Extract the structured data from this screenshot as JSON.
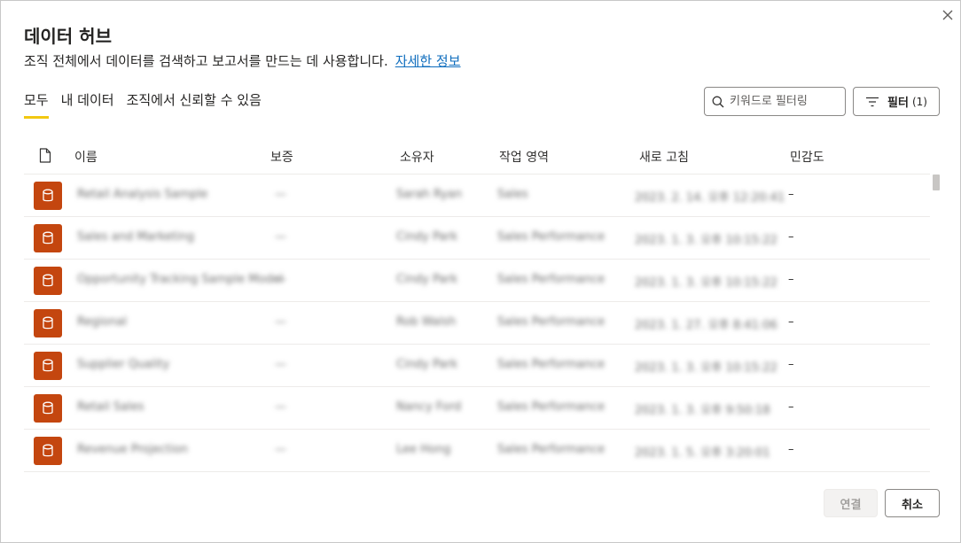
{
  "dialog": {
    "title": "데이터 허브",
    "subtitle": "조직 전체에서 데이터를 검색하고 보고서를 만드는 데 사용합니다.",
    "learn_more": "자세한 정보"
  },
  "tabs": [
    {
      "label": "모두",
      "active": true
    },
    {
      "label": "내 데이터",
      "active": false
    },
    {
      "label": "조직에서 신뢰할 수 있음",
      "active": false
    }
  ],
  "search": {
    "placeholder": "키워드로 필터링"
  },
  "filter": {
    "label": "필터",
    "count": "(1)"
  },
  "columns": {
    "icon": "document-icon",
    "name": "이름",
    "endorsement": "보증",
    "owner": "소유자",
    "workspace": "작업 영역",
    "refreshed": "새로 고침",
    "sensitivity": "민감도"
  },
  "rows": [
    {
      "name": "Retail Analysis Sample",
      "endorsement": "—",
      "owner": "Sarah Ryan",
      "workspace": "Sales",
      "refreshed": "2023. 2. 14. 오후 12:20:41",
      "sensitivity": "–"
    },
    {
      "name": "Sales and Marketing",
      "endorsement": "—",
      "owner": "Cindy Park",
      "workspace": "Sales Performance",
      "refreshed": "2023. 1. 3. 오후 10:15:22",
      "sensitivity": "–"
    },
    {
      "name": "Opportunity Tracking Sample Model",
      "endorsement": "—",
      "owner": "Cindy Park",
      "workspace": "Sales Performance",
      "refreshed": "2023. 1. 3. 오후 10:15:22",
      "sensitivity": "–"
    },
    {
      "name": "Regional",
      "endorsement": "—",
      "owner": "Rob Walsh",
      "workspace": "Sales Performance",
      "refreshed": "2023. 1. 27. 오후 8:41:06",
      "sensitivity": "–"
    },
    {
      "name": "Supplier Quality",
      "endorsement": "—",
      "owner": "Cindy Park",
      "workspace": "Sales Performance",
      "refreshed": "2023. 1. 3. 오후 10:15:22",
      "sensitivity": "–"
    },
    {
      "name": "Retail Sales",
      "endorsement": "—",
      "owner": "Nancy Ford",
      "workspace": "Sales Performance",
      "refreshed": "2023. 1. 3. 오후 9:50:18",
      "sensitivity": "–"
    },
    {
      "name": "Revenue Projection",
      "endorsement": "—",
      "owner": "Lee Hong",
      "workspace": "Sales Performance",
      "refreshed": "2023. 1. 5. 오후 3:20:01",
      "sensitivity": "–"
    }
  ],
  "actions": {
    "connect": "연결",
    "cancel": "취소"
  },
  "colors": {
    "accent_tab": "#f2c811",
    "dataset_icon": "#c4460f",
    "link": "#106ebe"
  }
}
